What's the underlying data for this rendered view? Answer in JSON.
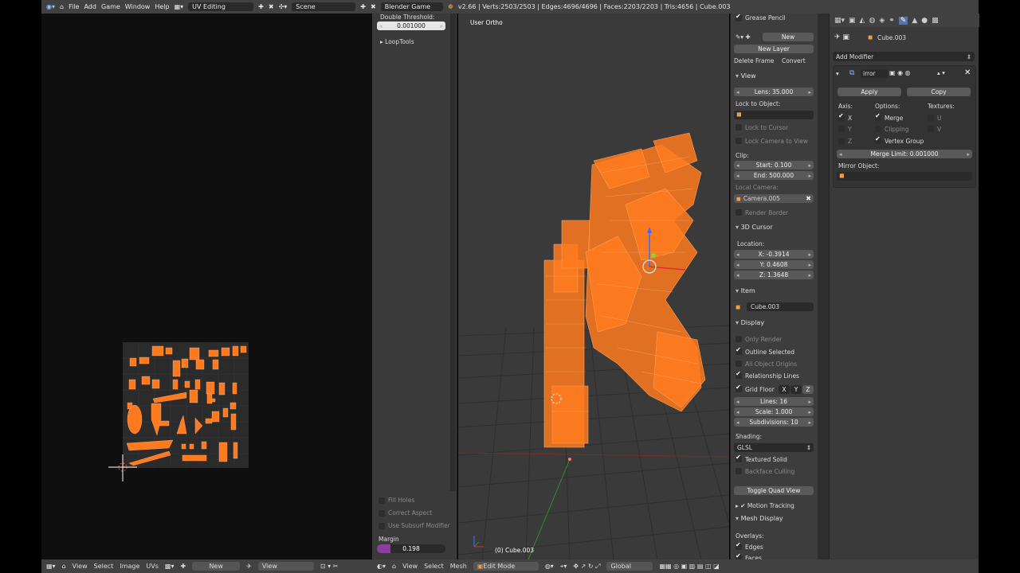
{
  "top_bar": {
    "menu": [
      "File",
      "Add",
      "Game",
      "Window",
      "Help"
    ],
    "layout": "UV Editing",
    "scene": "Scene",
    "engine": "Blender Game",
    "stats": "v2.66 | Verts:2503/2503 | Edges:4696/4696 | Faces:2203/2203 | Tris:4656 | Cube.003"
  },
  "toolshelf": {
    "double_threshold_label": "Double Threshold:",
    "double_threshold_value": "0.001000",
    "looptools": "LoopTools",
    "fill_holes": "Fill Holes",
    "correct_aspect": "Correct Aspect",
    "use_subsurf": "Use Subsurf Modifier",
    "margin_label": "Margin",
    "margin_value": "0.198"
  },
  "viewport": {
    "title": "User Ortho",
    "object_label": "(0) Cube.003"
  },
  "props": {
    "grease_pencil": "Grease Pencil",
    "new": "New",
    "new_layer": "New Layer",
    "delete_frame": "Delete Frame",
    "convert": "Convert",
    "view_header": "View",
    "lens": "Lens: 35.000",
    "lock_to_object": "Lock to Object:",
    "lock_to_cursor": "Lock to Cursor",
    "lock_camera": "Lock Camera to View",
    "clip": "Clip:",
    "clip_start": "Start: 0.100",
    "clip_end": "End: 500.000",
    "local_camera": "Local Camera:",
    "camera_name": "Camera.005",
    "render_border": "Render Border",
    "cursor_header": "3D Cursor",
    "location": "Location:",
    "cursor_x": "X: -0.3914",
    "cursor_y": "Y: 0.4608",
    "cursor_z": "Z: 1.3648",
    "item_header": "Item",
    "item_name": "Cube.003",
    "display_header": "Display",
    "only_render": "Only Render",
    "outline_selected": "Outline Selected",
    "all_object_origins": "All Object Origins",
    "relationship_lines": "Relationship Lines",
    "grid_floor": "Grid Floor",
    "grid_x": "X",
    "grid_y": "Y",
    "grid_z": "Z",
    "lines": "Lines: 16",
    "scale": "Scale: 1.000",
    "subdivisions": "Subdivisions: 10",
    "shading": "Shading:",
    "shading_value": "GLSL",
    "textured_solid": "Textured Solid",
    "backface_culling": "Backface Culling",
    "toggle_quad": "Toggle Quad View",
    "motion_tracking": "Motion Tracking",
    "mesh_display": "Mesh Display",
    "overlays": "Overlays:",
    "edges": "Edges",
    "faces": "Faces"
  },
  "modifier_panel": {
    "object_name": "Cube.003",
    "add_modifier": "Add Modifier",
    "modifier_name": "irror",
    "apply": "Apply",
    "copy": "Copy",
    "axis": "Axis:",
    "options": "Options:",
    "textures": "Textures:",
    "x": "X",
    "y": "Y",
    "z": "Z",
    "merge": "Merge",
    "clipping": "Clipping",
    "vertex_group": "Vertex Group",
    "u": "U",
    "v": "V",
    "merge_limit": "Merge Limit: 0.001000",
    "mirror_object": "Mirror Object:"
  },
  "uv_bottom_bar": {
    "view": "View",
    "select": "Select",
    "image": "Image",
    "uvs": "UVs",
    "new": "New",
    "view2": "View"
  },
  "view3d_bottom_bar": {
    "view": "View",
    "select": "Select",
    "mesh": "Mesh",
    "mode": "Edit Mode",
    "orientation": "Global"
  },
  "colors": {
    "accent_orange": "#ff7a1f",
    "margin_bar": "#8a3fa0"
  }
}
